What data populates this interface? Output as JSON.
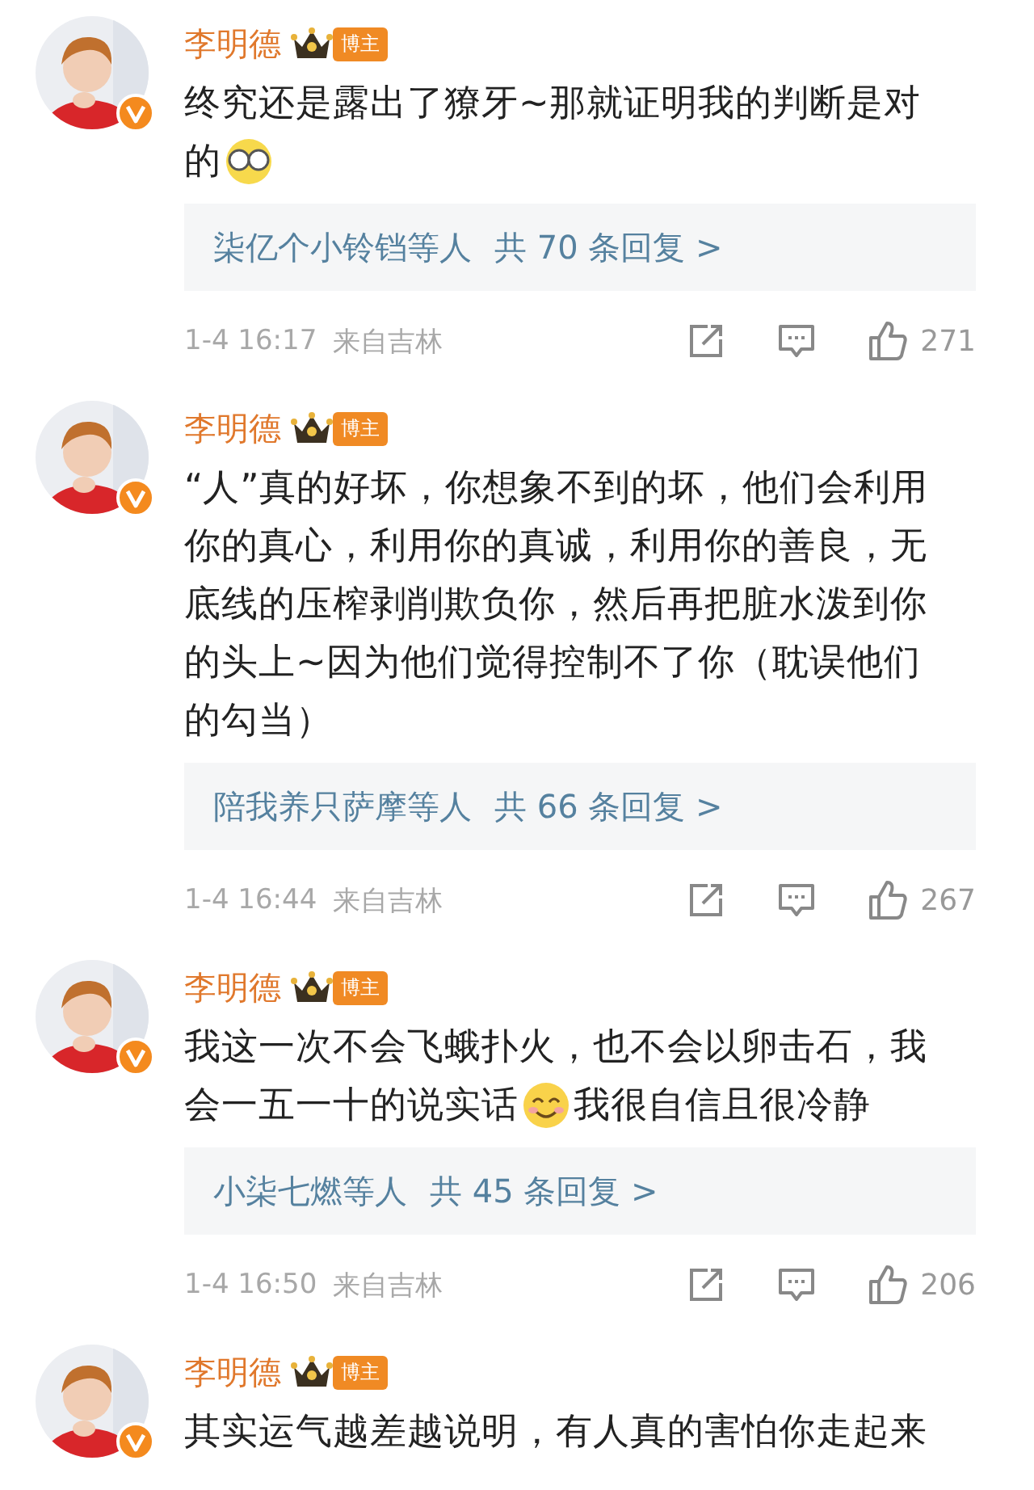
{
  "comments": [
    {
      "author": "李明德",
      "badge": "博主",
      "verified": true,
      "lines": [
        [
          {
            "kind": "text",
            "text": "终究还是露出了獠牙~那就证明我的判断是对"
          }
        ],
        [
          {
            "kind": "text",
            "text": "的"
          },
          {
            "kind": "glasses"
          }
        ]
      ],
      "replies": {
        "names": "柒亿个小铃铛等人",
        "count": "共 70 条回复 >"
      },
      "time": "1-4 16:17",
      "location": "来自吉林",
      "likes": "271"
    },
    {
      "author": "李明德",
      "badge": "博主",
      "verified": true,
      "lines": [
        [
          {
            "kind": "text",
            "text": "“人”真的好坏，你想象不到的坏，他们会利用"
          }
        ],
        [
          {
            "kind": "text",
            "text": "你的真心，利用你的真诚，利用你的善良，无"
          }
        ],
        [
          {
            "kind": "text",
            "text": "底线的压榨剥削欺负你，然后再把脏水泼到你"
          }
        ],
        [
          {
            "kind": "text",
            "text": "的头上~因为他们觉得控制不了你（耽误他们"
          }
        ],
        [
          {
            "kind": "text",
            "text": "的勾当）"
          }
        ]
      ],
      "replies": {
        "names": "陪我养只萨摩等人",
        "count": "共 66 条回复 >"
      },
      "time": "1-4 16:44",
      "location": "来自吉林",
      "likes": "267"
    },
    {
      "author": "李明德",
      "badge": "博主",
      "verified": true,
      "lines": [
        [
          {
            "kind": "text",
            "text": "我这一次不会飞蛾扑火，也不会以卵击石，我"
          }
        ],
        [
          {
            "kind": "text",
            "text": "会一五一十的说实话"
          },
          {
            "kind": "smile"
          },
          {
            "kind": "text",
            "text": "我很自信且很冷静"
          }
        ]
      ],
      "replies": {
        "names": "小柒七燃等人",
        "count": "共 45 条回复 >"
      },
      "time": "1-4 16:50",
      "location": "来自吉林",
      "likes": "206"
    },
    {
      "author": "李明德",
      "badge": "博主",
      "verified": true,
      "lines": [
        [
          {
            "kind": "text",
            "text": "其实运气越差越说明，有人真的害怕你走起来"
          }
        ]
      ]
    }
  ]
}
